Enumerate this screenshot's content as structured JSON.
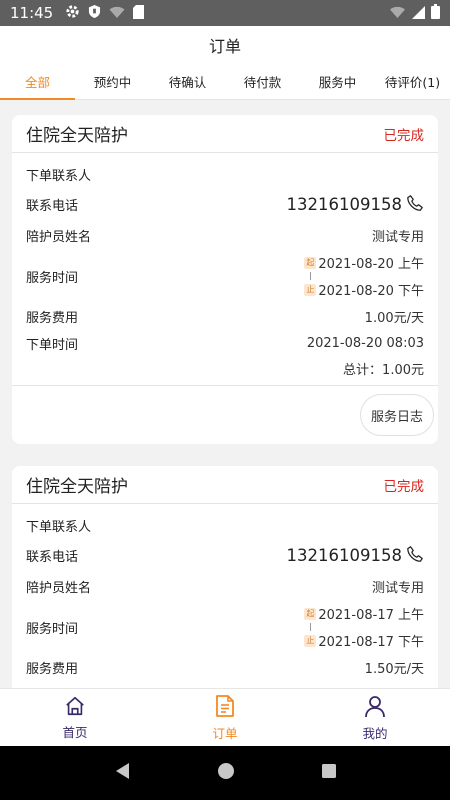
{
  "status_bar": {
    "time": "11:45"
  },
  "header": {
    "title": "订单"
  },
  "tabs": [
    {
      "label": "全部",
      "active": true
    },
    {
      "label": "预约中",
      "active": false
    },
    {
      "label": "待确认",
      "active": false
    },
    {
      "label": "待付款",
      "active": false
    },
    {
      "label": "服务中",
      "active": false
    },
    {
      "label": "待评价(1)",
      "active": false
    }
  ],
  "labels": {
    "contact": "下单联系人",
    "phone": "联系电话",
    "caregiver": "陪护员姓名",
    "service_time": "服务时间",
    "fee": "服务费用",
    "order_time": "下单时间",
    "start_tag": "起",
    "end_tag": "止",
    "log_button": "服务日志"
  },
  "orders": [
    {
      "title": "住院全天陪护",
      "status": "已完成",
      "contact": "",
      "phone": "13216109158",
      "caregiver": "测试专用",
      "start": "2021-08-20 上午",
      "end": "2021-08-20 下午",
      "fee": "1.00元/天",
      "order_time": "2021-08-20 08:03",
      "total": "总计：1.00元"
    },
    {
      "title": "住院全天陪护",
      "status": "已完成",
      "contact": "",
      "phone": "13216109158",
      "caregiver": "测试专用",
      "start": "2021-08-17 上午",
      "end": "2021-08-17 下午",
      "fee": "1.50元/天"
    }
  ],
  "bottom_nav": [
    {
      "label": "首页",
      "icon": "home-icon",
      "active": false
    },
    {
      "label": "订单",
      "icon": "order-document-icon",
      "active": true
    },
    {
      "label": "我的",
      "icon": "user-icon",
      "active": false
    }
  ],
  "colors": {
    "accent": "#f08a24",
    "status_done": "#d7261e",
    "nav_inactive": "#3a2a6b"
  }
}
